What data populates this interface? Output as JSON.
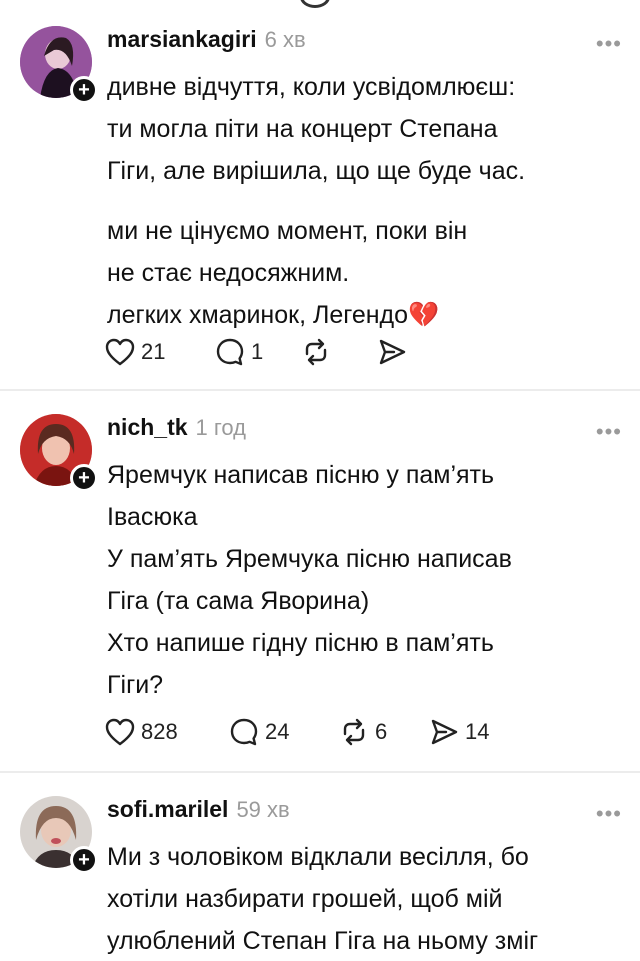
{
  "posts": [
    {
      "username": "marsiankagiri",
      "timestamp": "6 хв",
      "more": "•••",
      "paragraphs": [
        [
          "дивне відчуття, коли усвідомлюєш:",
          "ти могла піти на концерт Степана",
          "Гіги, але вирішила, що ще буде час."
        ],
        [
          "ми не цінуємо момент, поки він",
          "не стає недосяжним.",
          "легких хмаринок, Легендо"
        ]
      ],
      "emoji": "💔",
      "likes": "21",
      "replies": "1",
      "reposts": "",
      "shares": ""
    },
    {
      "username": "nich_tk",
      "timestamp": "1 год",
      "more": "•••",
      "paragraphs": [
        [
          "Яремчук написав пісню у пам’ять",
          "Івасюка",
          "У пам’ять Яремчука пісню написав",
          "Гіга (та сама Яворина)",
          "Хто напише гідну пісню в пам’ять",
          "Гіги?"
        ]
      ],
      "likes": "828",
      "replies": "24",
      "reposts": "6",
      "shares": "14"
    },
    {
      "username": "sofi.marilel",
      "timestamp": "59 хв",
      "more": "•••",
      "paragraphs": [
        [
          "Ми з чоловіком відклали весілля, бо",
          "хотіли назбирати грошей, щоб мій",
          "улюблений Степан Гіга на ньому зміг"
        ]
      ]
    }
  ],
  "colors": {
    "text": "#111111",
    "muted": "#9a9a9a",
    "divider": "#ececec"
  }
}
